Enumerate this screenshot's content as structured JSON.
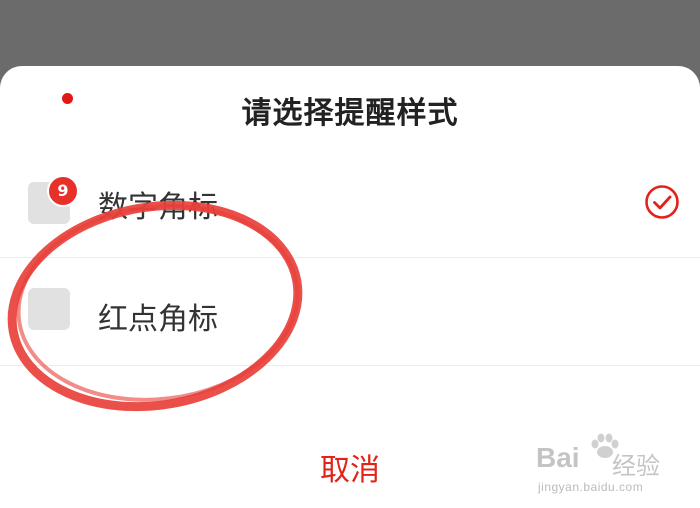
{
  "sheet": {
    "title": "请选择提醒样式",
    "options": [
      {
        "label": "数字角标",
        "badge": "9",
        "selected": true
      },
      {
        "label": "红点角标",
        "selected": false
      }
    ],
    "cancel_label": "取消"
  },
  "watermark": {
    "brand": "Bai",
    "brand_cn": "经验",
    "url": "jingyan.baidu.com"
  },
  "colors": {
    "accent": "#e2231a",
    "overlay": "#6b6b6b",
    "annotation": "#e8403a"
  },
  "icons": {
    "selected": "check-circle-icon",
    "app": "app-placeholder-icon"
  }
}
